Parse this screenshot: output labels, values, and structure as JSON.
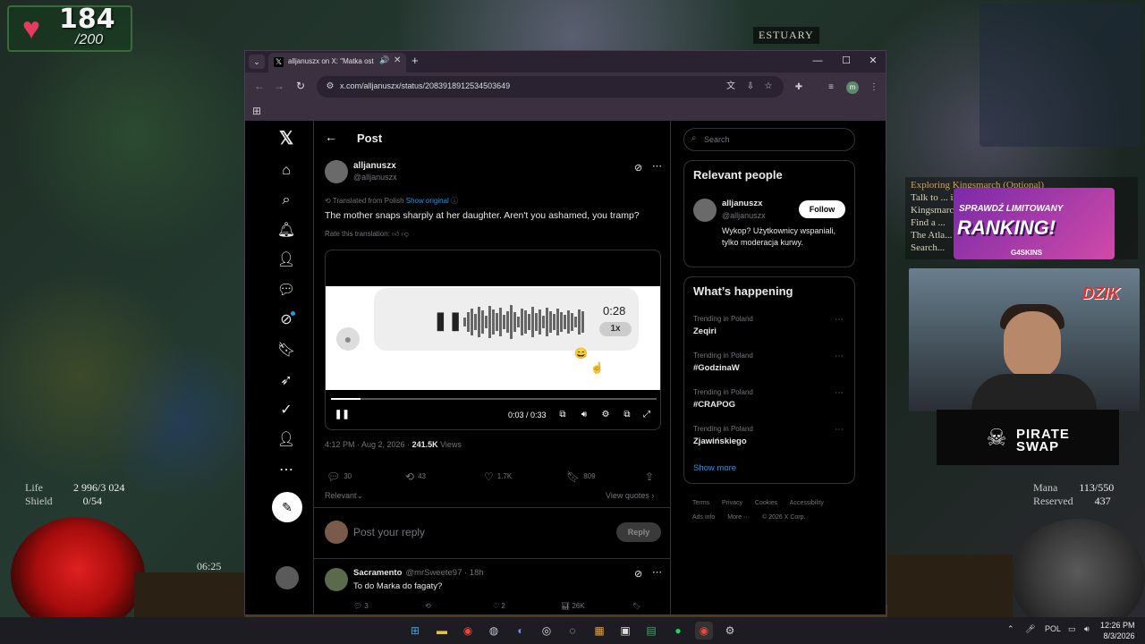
{
  "game": {
    "level": "184",
    "level_max": "/200",
    "location": "ESTUARY",
    "quest_lines": [
      "Exploring Kingsmarch (Optional)",
      "Talk to ... in the Kanu Shrine to visit",
      "Kingsmarch",
      "Find a ...",
      "The Atla...",
      "Search..."
    ],
    "life_label": "Life",
    "life_value": "2 996/3 024",
    "shield_label": "Shield",
    "shield_value": "0/54",
    "mana_label": "Mana",
    "mana_value": "113/550",
    "reserved_label": "Reserved",
    "reserved_value": "437",
    "timer": "06:25"
  },
  "overlays": {
    "promo_small": "SPRAWDŹ LIMITOWANY",
    "promo_big": "RANKING!",
    "promo_sub": "G4SKINS",
    "dzik": "DZIK",
    "pirate_line1": "PIRATE",
    "pirate_line2": "SWAP"
  },
  "browser": {
    "tab_title": "alljanuszx on X: \"Matka ost",
    "url": "x.com/alljanuszx/status/2083918912534503649"
  },
  "post": {
    "header_title": "Post",
    "author_name": "alljanuszx",
    "author_handle": "@alljanuszx",
    "translated_prefix": "Translated from Polish",
    "show_original": "Show original",
    "text": "The mother snaps sharply at her daughter. Aren't you ashamed, you tramp?",
    "rate_translation": "Rate this translation:",
    "voice_duration": "0:28",
    "voice_speed": "1x",
    "video_time": "0:03 / 0:33",
    "video_progress": 0.09,
    "timestamp": "4:12 PM · Aug 2, 2026 · ",
    "views_count": "241.5K",
    "views_label": " Views",
    "replies": "30",
    "reposts": "43",
    "likes": "1.7K",
    "bookmarks": "809",
    "relevant": "Relevant",
    "view_quotes": "View quotes",
    "reply_placeholder": "Post your reply",
    "reply_button": "Reply"
  },
  "reply": {
    "name": "Sacramento",
    "handle": "@mrSweete97 · 18h",
    "text": "To do Marka do fagaty?",
    "replies": "3",
    "likes": "2",
    "views": "26K"
  },
  "sidebar": {
    "search_placeholder": "Search",
    "relevant_title": "Relevant people",
    "person_name": "alljanuszx",
    "person_handle": "@alljanuszx",
    "follow": "Follow",
    "bio": "Wykop? Użytkownicy wspaniali, tylko moderacja kurwy.",
    "happening_title": "What’s happening",
    "trends": [
      {
        "context": "Trending in Poland",
        "name": "Zeqiri"
      },
      {
        "context": "Trending in Poland",
        "name": "#GodzinaW"
      },
      {
        "context": "Trending in Poland",
        "name": "#CRAPOG"
      },
      {
        "context": "Trending in Poland",
        "name": "Zjawińskiego"
      }
    ],
    "show_more": "Show more",
    "footer": [
      "Terms",
      "Privacy",
      "Cookies",
      "Accessibility",
      "Ads info",
      "More ···",
      "© 2026 X Corp."
    ]
  },
  "taskbar": {
    "lang": "POL",
    "time": "12:26 PM",
    "date": "8/3/2026"
  }
}
